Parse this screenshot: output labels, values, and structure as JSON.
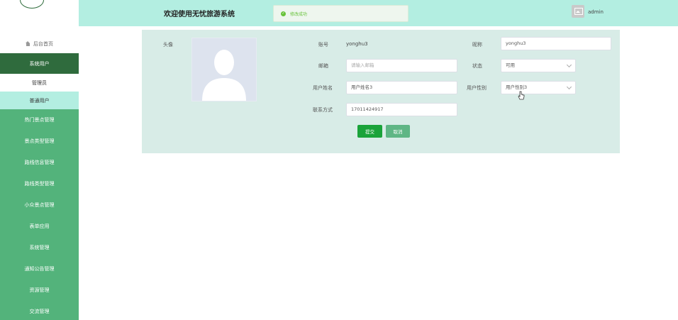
{
  "header": {
    "title": "欢迎使用无忧旅游系统",
    "toast": "修改成功",
    "username": "admin"
  },
  "sidebar": {
    "home": "后台首页",
    "section": "系统用户",
    "sub_items": [
      "管理员",
      "普通用户"
    ],
    "menu": [
      "热门景点管理",
      "景点类型管理",
      "路线信息管理",
      "路线类型管理",
      "小众景点管理",
      "表单应用",
      "系统管理",
      "通知公告管理",
      "资源管理",
      "交流管理"
    ]
  },
  "form": {
    "avatar_label": "头像",
    "account_label": "账号",
    "account_value": "yonghu3",
    "nickname_label": "昵称",
    "nickname_value": "yonghu3",
    "email_label": "邮箱",
    "email_placeholder": "请输入邮箱",
    "status_label": "状态",
    "status_value": "可用",
    "name_label": "用户姓名",
    "name_value": "用户姓名3",
    "gender_label": "用户性别",
    "gender_value": "用户性别3",
    "phone_label": "联系方式",
    "phone_value": "17011424917",
    "submit": "提交",
    "cancel": "取消"
  }
}
